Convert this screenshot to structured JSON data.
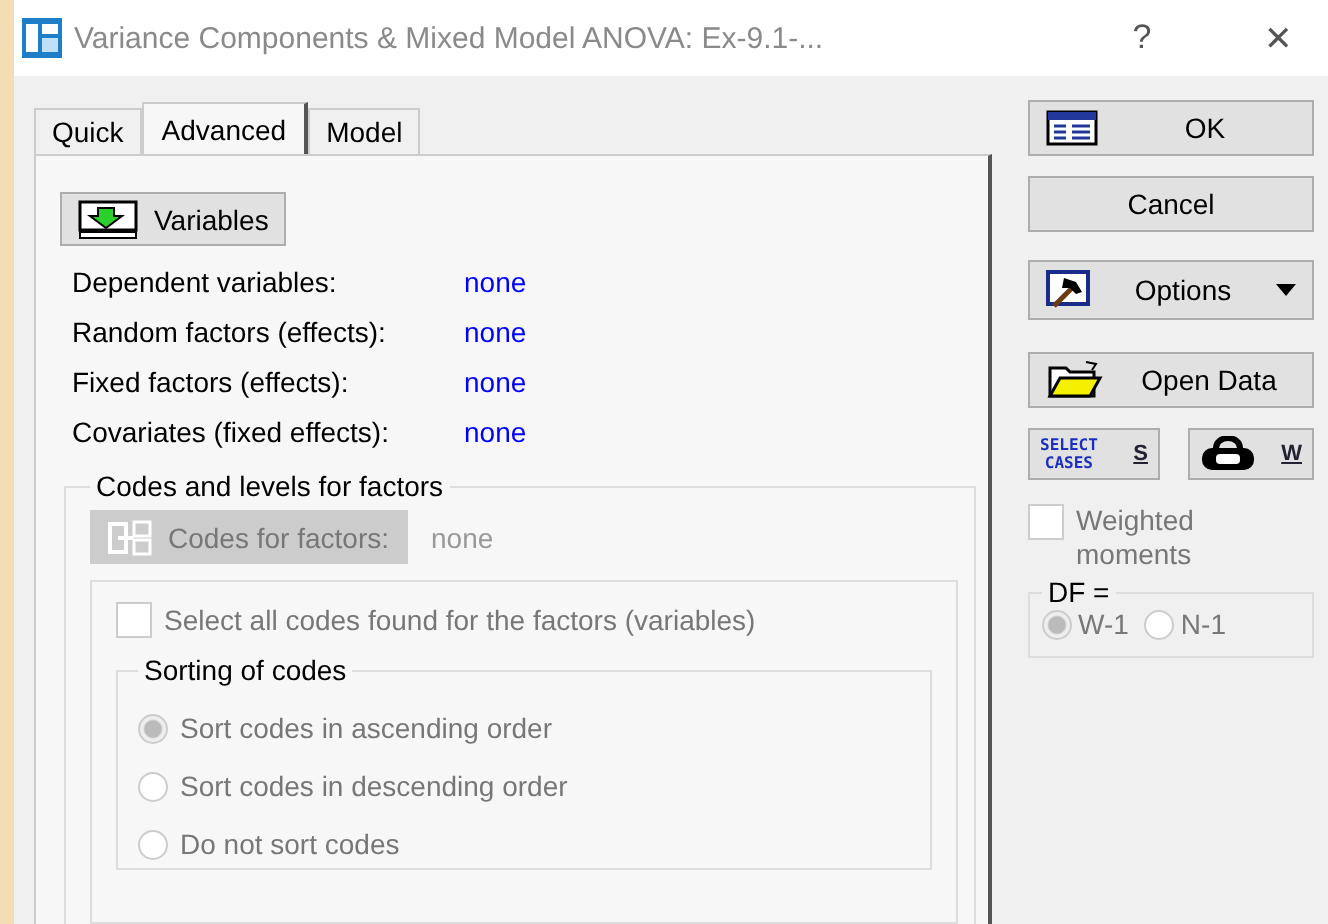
{
  "window": {
    "title": "Variance Components & Mixed Model ANOVA: Ex-9.1-...",
    "help": "?",
    "close": "✕"
  },
  "tabs": [
    {
      "label": "Quick",
      "selected": false
    },
    {
      "label": "Advanced",
      "selected": true
    },
    {
      "label": "Model",
      "selected": false
    }
  ],
  "variables_button": "Variables",
  "assignments": [
    {
      "label": "Dependent variables:",
      "value": "none"
    },
    {
      "label": "Random factors (effects):",
      "value": "none"
    },
    {
      "label": "Fixed factors (effects):",
      "value": "none"
    },
    {
      "label": "Covariates (fixed effects):",
      "value": "none"
    }
  ],
  "codes_group": {
    "title": "Codes and levels for factors",
    "button": "Codes for factors:",
    "button_disabled": true,
    "value": "none",
    "select_all": {
      "label": "Select all codes found for the factors (variables)",
      "checked": false,
      "disabled": true
    },
    "sorting": {
      "title": "Sorting of codes",
      "options": [
        {
          "label": "Sort codes in ascending order",
          "selected": true,
          "disabled": true
        },
        {
          "label": "Sort codes in descending order",
          "selected": false,
          "disabled": true
        },
        {
          "label": "Do not sort codes",
          "selected": false,
          "disabled": true
        }
      ]
    }
  },
  "buttons": {
    "ok": "OK",
    "cancel": "Cancel",
    "options": "Options",
    "open_data": "Open Data",
    "select_cases": {
      "icon_lines": [
        "SELECT",
        "CASES"
      ],
      "label": "S"
    },
    "weight": {
      "label": "W"
    }
  },
  "weighted_moments": {
    "label": "Weighted moments",
    "checked": false,
    "disabled": true
  },
  "df": {
    "title": "DF =",
    "options": [
      {
        "label": "W-1",
        "selected": true,
        "disabled": true
      },
      {
        "label": "N-1",
        "selected": false,
        "disabled": true
      }
    ]
  }
}
